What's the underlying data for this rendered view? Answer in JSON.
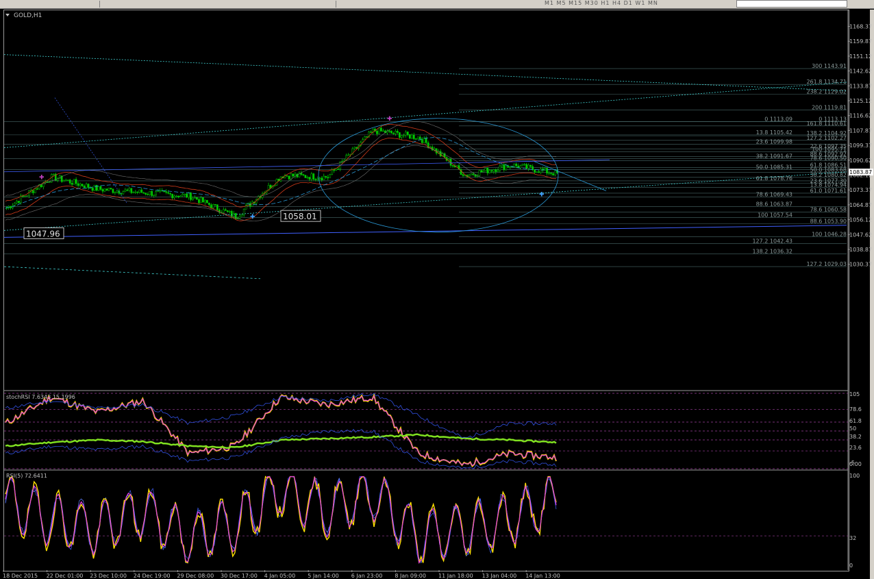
{
  "symbol_label": "GOLD,H1",
  "current_price": "1083.87",
  "panels": {
    "stoch_label": "stochRSI 7.6343 15.1996",
    "rsi_label": "RSI(5) 72.6411"
  },
  "price_axis": [
    "1168.37",
    "1159.87",
    "1151.12",
    "1142.62",
    "1133.87",
    "1125.12",
    "1116.62",
    "1107.87",
    "1099.37",
    "1090.62",
    "1082.12",
    "1073.37",
    "1064.87",
    "1056.12",
    "1047.62",
    "1038.87",
    "1030.37"
  ],
  "stoch_axis": [
    "105",
    "78.6",
    "61.8",
    "50",
    "38.2",
    "23.6",
    "-5",
    "0.00"
  ],
  "rsi_axis": [
    "100",
    "32",
    "0"
  ],
  "time_axis": [
    "18 Dec 2015",
    "22 Dec 01:00",
    "23 Dec 10:00",
    "24 Dec 19:00",
    "29 Dec 08:00",
    "30 Dec 17:00",
    "4 Jan 05:00",
    "5 Jan 14:00",
    "6 Jan 23:00",
    "8 Jan 09:00",
    "11 Jan 18:00",
    "13 Jan 04:00",
    "14 Jan 13:00"
  ],
  "price_callouts": [
    "1058.01",
    "1047.96"
  ],
  "timeframes": "M1 M5 M15 M30 H1 H4 D1 W1 MN",
  "fib_labels": [
    {
      "text": "300 1143.91",
      "price": 1143.91,
      "right": true
    },
    {
      "text": "261.8 1134.71",
      "price": 1134.71,
      "right": true
    },
    {
      "text": "238.2 1129.02",
      "price": 1129.02,
      "right": true
    },
    {
      "text": "200 1119.81",
      "price": 1119.81,
      "right": true
    },
    {
      "text": "0 1113.09",
      "price": 1113.09,
      "right": false
    },
    {
      "text": "0 1113.13",
      "price": 1113.13,
      "right": true
    },
    {
      "text": "161.8 1110.61",
      "price": 1110.61,
      "right": true
    },
    {
      "text": "13.8 1105.42",
      "price": 1105.42,
      "right": false
    },
    {
      "text": "138.2 1104.92",
      "price": 1104.92,
      "right": true
    },
    {
      "text": "127.2 1102.27",
      "price": 1102.27,
      "right": true
    },
    {
      "text": "23.6 1099.98",
      "price": 1099.98,
      "right": false
    },
    {
      "text": "22.6 1097.35",
      "price": 1097.35,
      "right": true
    },
    {
      "text": "100 1095.71",
      "price": 1095.71,
      "right": true
    },
    {
      "text": "88.6 1092.92",
      "price": 1092.92,
      "right": true
    },
    {
      "text": "38.2 1091.67",
      "price": 1091.67,
      "right": false
    },
    {
      "text": "78.6 1090.50",
      "price": 1090.5,
      "right": true
    },
    {
      "text": "61.8 1086.51",
      "price": 1086.51,
      "right": true
    },
    {
      "text": "50.0 1085.31",
      "price": 1085.31,
      "right": false
    },
    {
      "text": "50.0 1083.68",
      "price": 1083.68,
      "right": true
    },
    {
      "text": "38.2 1080.82",
      "price": 1080.82,
      "right": true
    },
    {
      "text": "61.8 1078.76",
      "price": 1078.76,
      "right": false
    },
    {
      "text": "23.6 1077.30",
      "price": 1077.3,
      "right": true
    },
    {
      "text": "13.8 1074.94",
      "price": 1074.94,
      "right": true
    },
    {
      "text": "61.0 1071.61",
      "price": 1071.61,
      "right": true
    },
    {
      "text": "78.6 1069.43",
      "price": 1069.43,
      "right": false
    },
    {
      "text": "88.6 1063.87",
      "price": 1063.87,
      "right": false
    },
    {
      "text": "78.6 1060.58",
      "price": 1060.58,
      "right": true
    },
    {
      "text": "100 1057.54",
      "price": 1057.54,
      "right": false
    },
    {
      "text": "88.6 1053.90",
      "price": 1053.9,
      "right": true
    },
    {
      "text": "100 1046.28",
      "price": 1046.28,
      "right": true
    },
    {
      "text": "127.2 1042.43",
      "price": 1042.43,
      "right": false
    },
    {
      "text": "138.2 1036.32",
      "price": 1036.32,
      "right": false
    },
    {
      "text": "127.2 1029.03",
      "price": 1029.03,
      "right": true
    }
  ],
  "colors": {
    "background": "#000000",
    "bull_candle": "#00c800",
    "bear_candle": "#00c800",
    "fib_line": "#4a6a6a",
    "fib_text": "#8a9a9a",
    "band_blue": "#2a9ad8",
    "band_red": "#d03a1a",
    "trend_cyan": "#40d0d0",
    "trend_blue": "#4060ff",
    "stoch_yellow": "#ffe000",
    "stoch_magenta": "#e040e0",
    "stoch_green": "#80e020",
    "level_magenta": "#a040a0",
    "axis_text": "#c0c0c0",
    "current_price_bg": "#ffffff"
  },
  "chart_data": {
    "type": "line",
    "title": "GOLD,H1",
    "ylim": [
      1028,
      1172
    ],
    "x": [
      "18 Dec 2015",
      "22 Dec 01:00",
      "23 Dec 10:00",
      "24 Dec 19:00",
      "29 Dec 08:00",
      "30 Dec 17:00",
      "4 Jan 05:00",
      "5 Jan 14:00",
      "6 Jan 23:00",
      "8 Jan 09:00",
      "11 Jan 18:00",
      "13 Jan 04:00",
      "14 Jan 13:00"
    ],
    "series": [
      {
        "values": [
          1063,
          1081,
          1074,
          1072,
          1070,
          1058,
          1082,
          1081,
          1108,
          1104,
          1082,
          1088,
          1083
        ]
      }
    ],
    "subplots": [
      {
        "ylim": [
          0,
          100
        ],
        "series": [
          {
            "values": [
              60,
              95,
              75,
              90,
              20,
              30,
              95,
              85,
              95,
              20,
              5,
              20,
              15
            ]
          }
        ]
      },
      {
        "ylim": [
          0,
          100
        ],
        "series": [
          {
            "values": [
              70,
              50,
              40,
              60,
              30,
              45,
              85,
              60,
              80,
              30,
              40,
              50,
              72.6
            ]
          }
        ]
      }
    ]
  }
}
